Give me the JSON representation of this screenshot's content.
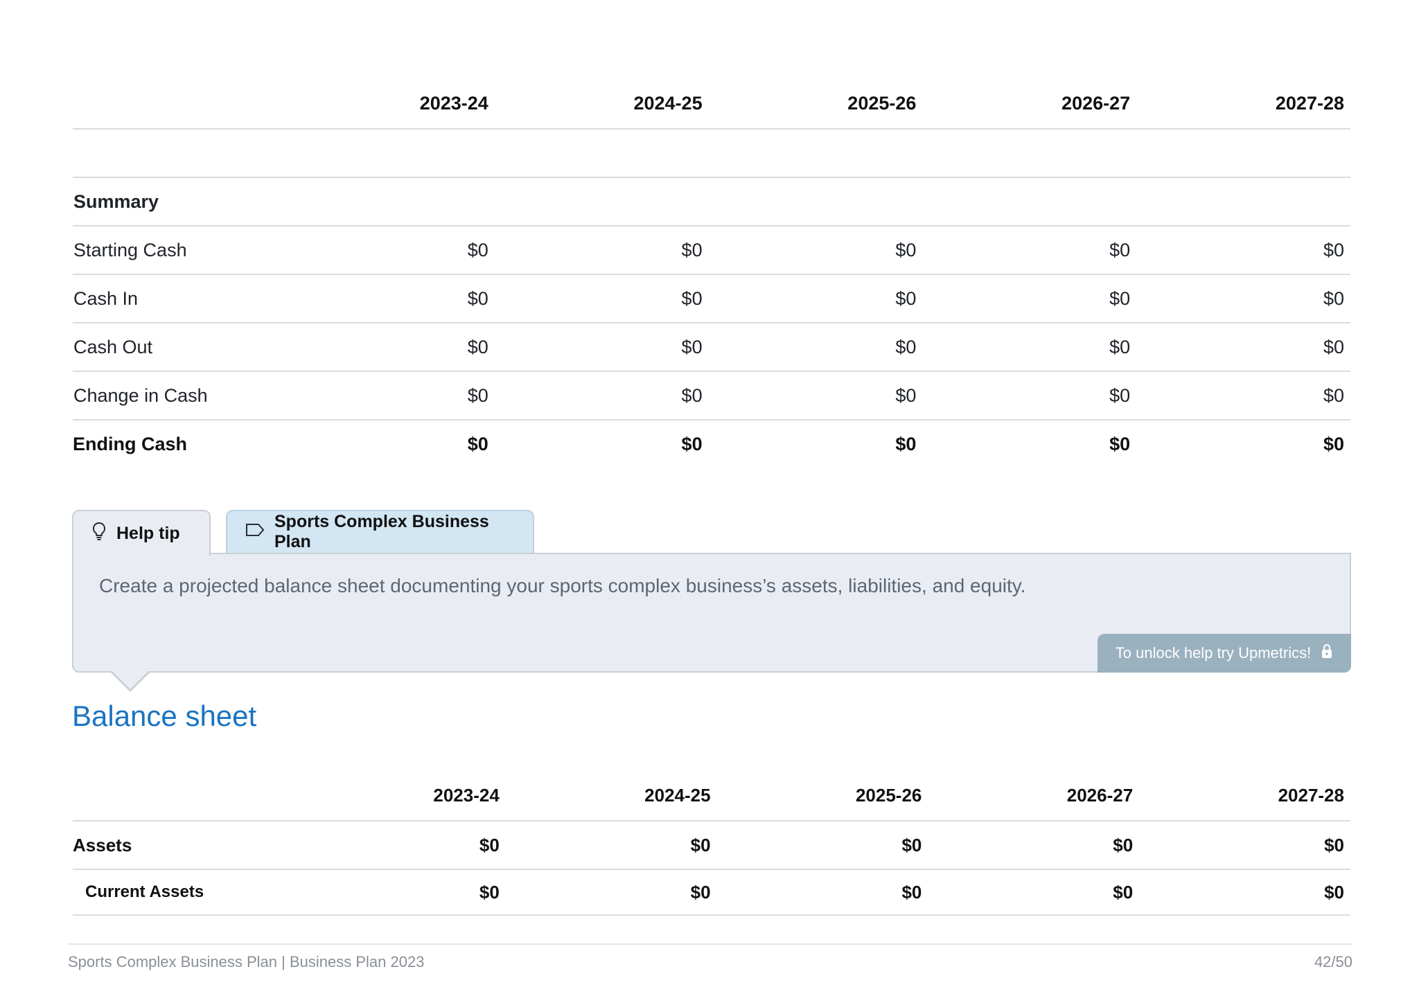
{
  "cash_flow": {
    "years": [
      "2023-24",
      "2024-25",
      "2025-26",
      "2026-27",
      "2027-28"
    ],
    "section_label": "Summary",
    "rows": [
      {
        "label": "Starting Cash",
        "values": [
          "$0",
          "$0",
          "$0",
          "$0",
          "$0"
        ]
      },
      {
        "label": "Cash In",
        "values": [
          "$0",
          "$0",
          "$0",
          "$0",
          "$0"
        ]
      },
      {
        "label": "Cash Out",
        "values": [
          "$0",
          "$0",
          "$0",
          "$0",
          "$0"
        ]
      },
      {
        "label": "Change in Cash",
        "values": [
          "$0",
          "$0",
          "$0",
          "$0",
          "$0"
        ]
      }
    ],
    "total": {
      "label": "Ending Cash",
      "values": [
        "$0",
        "$0",
        "$0",
        "$0",
        "$0"
      ]
    }
  },
  "help_tip": {
    "tab_help_label": "Help tip",
    "tab_plan_label": "Sports Complex Business Plan",
    "text": "Create a projected balance sheet documenting your sports complex business’s assets, liabilities, and equity.",
    "unlock_label": "To unlock help try Upmetrics!"
  },
  "balance_sheet": {
    "title": "Balance sheet",
    "years": [
      "2023-24",
      "2024-25",
      "2025-26",
      "2026-27",
      "2027-28"
    ],
    "rows": [
      {
        "label": "Assets",
        "values": [
          "$0",
          "$0",
          "$0",
          "$0",
          "$0"
        ]
      },
      {
        "label": "Current Assets",
        "values": [
          "$0",
          "$0",
          "$0",
          "$0",
          "$0"
        ]
      }
    ]
  },
  "footer": {
    "left": "Sports Complex Business Plan | Business Plan 2023",
    "page": "42/50"
  },
  "icons": {
    "help": "lightbulb-icon",
    "plan": "tag-icon",
    "unlock": "lock-icon"
  }
}
